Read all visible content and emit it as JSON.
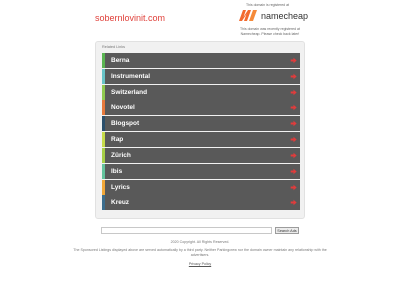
{
  "header": {
    "domain": "sobernlovinit.com",
    "registered_note": "This domain is registered at",
    "registrar_brand": "namecheap",
    "registrar_subtext": "This domain was recently registered at Namecheap. Please check back later!"
  },
  "related": {
    "title": "Related Links",
    "links": [
      {
        "label": "Berna",
        "stripe": "#5ab552"
      },
      {
        "label": "Instrumental",
        "stripe": "#67c3c7"
      },
      {
        "label": "Switzerland",
        "stripe": "#90ca4f"
      },
      {
        "label": "Novotel",
        "stripe": "#e6793c"
      },
      {
        "label": "Blogspot",
        "stripe": "#2b4f6b"
      },
      {
        "label": "Rap",
        "stripe": "#c6dc4a"
      },
      {
        "label": "Zürich",
        "stripe": "#a6cf47"
      },
      {
        "label": "Ibis",
        "stripe": "#63c39d"
      },
      {
        "label": "Lyrics",
        "stripe": "#f1a839"
      },
      {
        "label": "Kreuz",
        "stripe": "#3b6d8d"
      }
    ],
    "arrow_color": "#e03c3c"
  },
  "search": {
    "value": "",
    "placeholder": "",
    "button_label": "Search Ads"
  },
  "footer": {
    "copyright": "2020 Copyright. All Rights Reserved.",
    "disclaimer": "The Sponsored Listings displayed above are served automatically by a third party. Neither Parkingcrew nor the domain owner maintain any relationship with the advertisers.",
    "privacy_label": "Privacy Policy"
  },
  "colors": {
    "domain": "#e0403a",
    "row_bg": "#595959",
    "logo_orange": "#f26a2e"
  }
}
